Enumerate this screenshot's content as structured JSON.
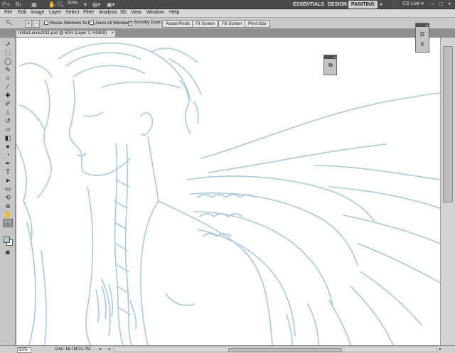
{
  "app": {
    "logo": "Ps",
    "zoom_value": "50%",
    "workspaces": [
      "ESSENTIALS",
      "DESIGN",
      "PAINTING"
    ],
    "active_workspace": "PAINTING",
    "more": "»",
    "cslive": "CS Live ▾"
  },
  "menu": [
    "File",
    "Edit",
    "Image",
    "Layer",
    "Select",
    "Filter",
    "Analysis",
    "3D",
    "View",
    "Window",
    "Help"
  ],
  "options": {
    "resize_windows": "Resize Windows To Fit",
    "zoom_all_windows": "Zoom All Windows",
    "scrubby_zoom": "Scrubby Zoom",
    "actual_pixels": "Actual Pixels",
    "fit_screen": "Fit Screen",
    "fill_screen": "Fill Screen",
    "print_size": "Print Size"
  },
  "document": {
    "tab_title": "IshtarLance2011.psd @ 50% (Layer 1, RGB/8)",
    "close": "×"
  },
  "status": {
    "zoom": "50%",
    "doc_size": "Doc: 16.7M/21.7M"
  },
  "colors": {
    "sketch_stroke": "#a9cad9",
    "foreground": "#a9cad9",
    "background": "#ffffff",
    "active_workspace_bg": "#cfcfcf"
  },
  "icons": {
    "tools": [
      "move-icon",
      "marquee-icon",
      "lasso-icon",
      "quick-select-icon",
      "crop-icon",
      "eyedropper-icon",
      "healing-brush-icon",
      "brush-icon",
      "clone-stamp-icon",
      "history-brush-icon",
      "eraser-icon",
      "gradient-icon",
      "blur-icon",
      "dodge-icon",
      "pen-icon",
      "type-icon",
      "path-select-icon",
      "shape-icon",
      "3d-rotate-icon",
      "3d-orbit-icon",
      "hand-icon",
      "zoom-icon"
    ]
  }
}
